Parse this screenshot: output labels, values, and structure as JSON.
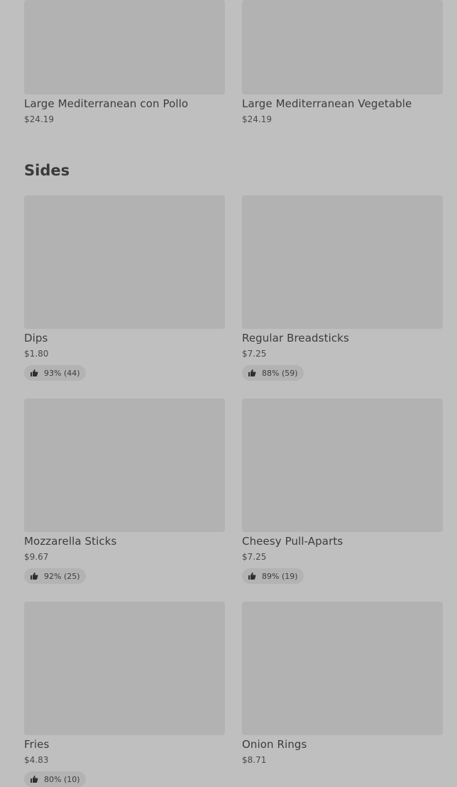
{
  "top_items": [
    {
      "name": "Large Mediterranean con Pollo",
      "price": "$24.19"
    },
    {
      "name": "Large Mediterranean Vegetable",
      "price": "$24.19"
    }
  ],
  "sides": {
    "title": "Sides",
    "items": [
      {
        "name": "Dips",
        "price": "$1.80",
        "rating": "93% (44)"
      },
      {
        "name": "Regular Breadsticks",
        "price": "$7.25",
        "rating": "88% (59)"
      },
      {
        "name": "Mozzarella Sticks",
        "price": "$9.67",
        "rating": "92% (25)"
      },
      {
        "name": "Cheesy Pull-Aparts",
        "price": "$7.25",
        "rating": "89% (19)"
      },
      {
        "name": "Fries",
        "price": "$4.83",
        "rating": "80% (10)"
      },
      {
        "name": "Onion Rings",
        "price": "$8.71",
        "rating": ""
      }
    ]
  },
  "icons": {
    "rating": "thumbs-up-icon"
  },
  "colors": {
    "overlay": "#bfbfbf",
    "placeholder": "#b2b2b2"
  }
}
